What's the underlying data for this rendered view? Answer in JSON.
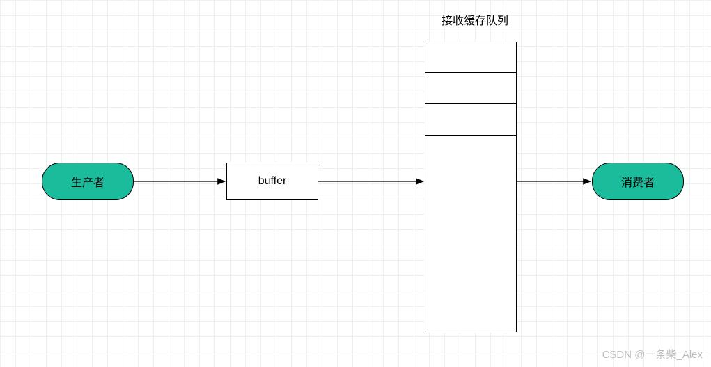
{
  "diagram": {
    "producer": {
      "label": "生产者"
    },
    "buffer": {
      "label": "buffer"
    },
    "queue": {
      "title": "接收缓存队列",
      "segments": 4
    },
    "consumer": {
      "label": "消费者"
    }
  },
  "watermark": "CSDN @一条柴_Alex",
  "colors": {
    "pill_fill": "#1abc9c",
    "stroke": "#000000",
    "grid": "#f0f0f0"
  }
}
